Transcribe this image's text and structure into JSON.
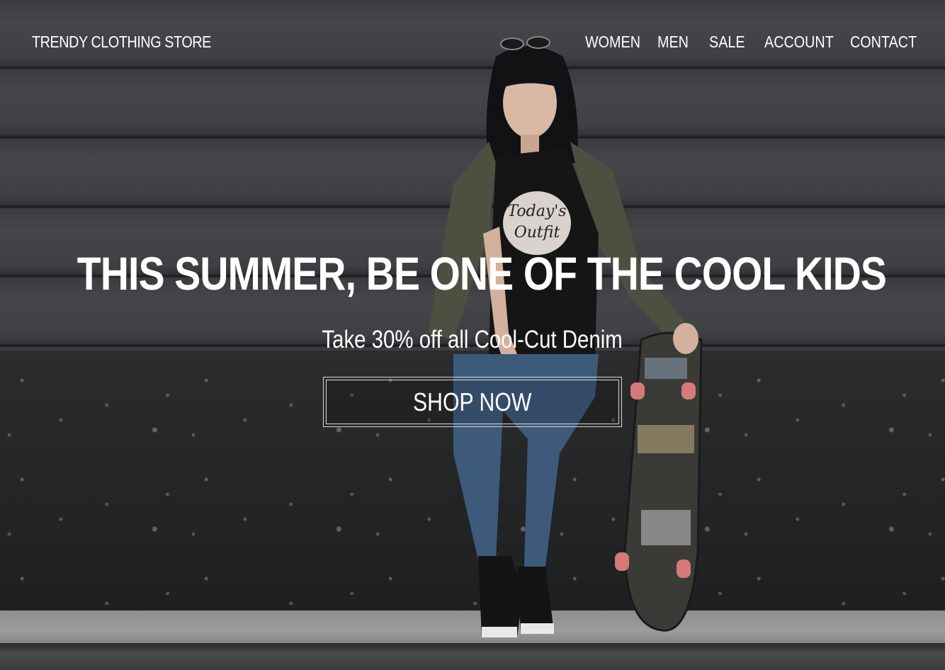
{
  "header": {
    "logo": "TRENDY CLOTHING STORE",
    "nav": [
      {
        "label": "WOMEN"
      },
      {
        "label": "MEN"
      },
      {
        "label": "SALE"
      },
      {
        "label": "ACCOUNT"
      },
      {
        "label": "CONTACT"
      }
    ]
  },
  "hero": {
    "headline": "THIS SUMMER, BE ONE OF THE COOL KIDS",
    "subheadline": "Take 30% off all Cool-Cut Denim",
    "cta_label": "SHOP NOW",
    "shirt_text": "Today's Outfit"
  },
  "colors": {
    "text": "#ffffff",
    "wall": "#3f4043",
    "button_border": "#d8d8d8"
  }
}
